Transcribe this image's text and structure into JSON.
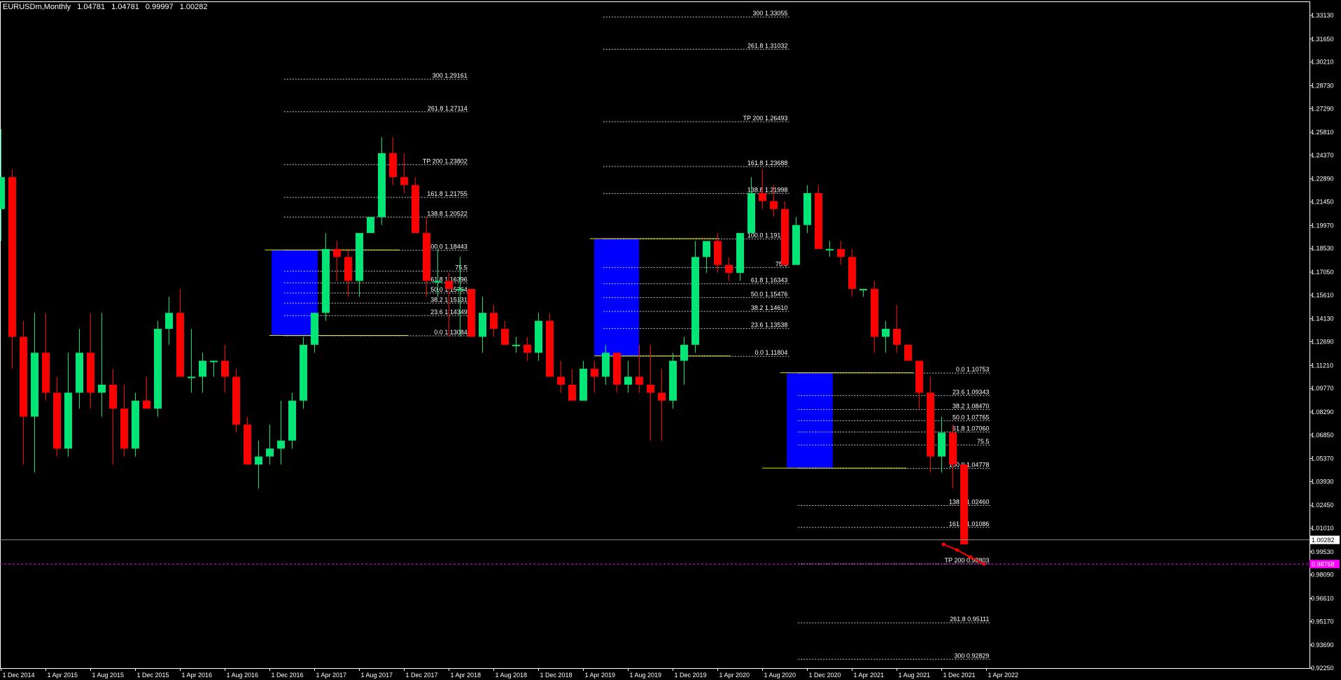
{
  "window": {
    "symbol": "EURUSDm,Monthly",
    "ohlc": [
      "1.04781",
      "1.04781",
      "0.99997",
      "1.00282"
    ]
  },
  "colors": {
    "background": "#000000",
    "bull": "#00e676",
    "bear": "#ff0000",
    "axis_text": "#ffffff",
    "fib_line": "#c8c8c8",
    "box": "#0000ff",
    "anchor_line": "#e6e600",
    "bid_line": "#8a8a8a",
    "target_line": "#ff00ff",
    "target_label_bg": "#ff00ff"
  },
  "price_axis": {
    "labels": [
      "1.33130",
      "1.31650",
      "1.30210",
      "1.28730",
      "1.27290",
      "1.25810",
      "1.24370",
      "1.22890",
      "1.21450",
      "1.19970",
      "1.18530",
      "1.17050",
      "1.15610",
      "1.14130",
      "1.12690",
      "1.11210",
      "1.09770",
      "1.08290",
      "1.06850",
      "1.05370",
      "1.03930",
      "1.02450",
      "1.01010",
      "0.99530",
      "0.98090",
      "0.96610",
      "0.95170",
      "0.93690",
      "0.92250"
    ],
    "current_price": "1.00282",
    "target_price": "0.98768"
  },
  "time_axis": {
    "labels": [
      "1 Dec 2014",
      "1 Apr 2015",
      "1 Aug 2015",
      "1 Dec 2015",
      "1 Apr 2016",
      "1 Aug 2016",
      "1 Dec 2016",
      "1 Apr 2017",
      "1 Aug 2017",
      "1 Dec 2017",
      "1 Apr 2018",
      "1 Aug 2018",
      "1 Dec 2018",
      "1 Apr 2019",
      "1 Aug 2019",
      "1 Dec 2019",
      "1 Apr 2020",
      "1 Aug 2020",
      "1 Dec 2020",
      "1 Apr 2021",
      "1 Aug 2021",
      "1 Dec 2021",
      "1 Apr 2022"
    ]
  },
  "chart_data": {
    "type": "candlestick",
    "first_bar": "1 Dec 2014",
    "y_range": [
      0.9225,
      1.3385
    ],
    "candles": [
      [
        1.21,
        1.26,
        1.19,
        1.23
      ],
      [
        1.23,
        1.235,
        1.11,
        1.13
      ],
      [
        1.13,
        1.14,
        1.05,
        1.08
      ],
      [
        1.08,
        1.145,
        1.045,
        1.12
      ],
      [
        1.12,
        1.145,
        1.09,
        1.095
      ],
      [
        1.095,
        1.105,
        1.055,
        1.06
      ],
      [
        1.06,
        1.12,
        1.055,
        1.095
      ],
      [
        1.095,
        1.135,
        1.085,
        1.12
      ],
      [
        1.12,
        1.145,
        1.085,
        1.095
      ],
      [
        1.095,
        1.145,
        1.08,
        1.1
      ],
      [
        1.1,
        1.11,
        1.05,
        1.085
      ],
      [
        1.085,
        1.1,
        1.055,
        1.06
      ],
      [
        1.06,
        1.095,
        1.055,
        1.09
      ],
      [
        1.09,
        1.105,
        1.085,
        1.085
      ],
      [
        1.085,
        1.14,
        1.08,
        1.135
      ],
      [
        1.135,
        1.155,
        1.125,
        1.145
      ],
      [
        1.145,
        1.16,
        1.105,
        1.105
      ],
      [
        1.105,
        1.135,
        1.095,
        1.105
      ],
      [
        1.105,
        1.12,
        1.095,
        1.115
      ],
      [
        1.115,
        1.115,
        1.105,
        1.115
      ],
      [
        1.115,
        1.125,
        1.095,
        1.105
      ],
      [
        1.105,
        1.11,
        1.07,
        1.075
      ],
      [
        1.075,
        1.08,
        1.05,
        1.05
      ],
      [
        1.05,
        1.065,
        1.035,
        1.055
      ],
      [
        1.055,
        1.075,
        1.05,
        1.06
      ],
      [
        1.06,
        1.09,
        1.05,
        1.065
      ],
      [
        1.065,
        1.095,
        1.06,
        1.09
      ],
      [
        1.09,
        1.13,
        1.085,
        1.125
      ],
      [
        1.125,
        1.145,
        1.12,
        1.145
      ],
      [
        1.145,
        1.195,
        1.14,
        1.185
      ],
      [
        1.185,
        1.19,
        1.165,
        1.18
      ],
      [
        1.18,
        1.185,
        1.155,
        1.165
      ],
      [
        1.165,
        1.195,
        1.155,
        1.195
      ],
      [
        1.195,
        1.205,
        1.195,
        1.205
      ],
      [
        1.205,
        1.255,
        1.2,
        1.245
      ],
      [
        1.245,
        1.255,
        1.225,
        1.23
      ],
      [
        1.23,
        1.245,
        1.22,
        1.225
      ],
      [
        1.225,
        1.23,
        1.215,
        1.195
      ],
      [
        1.195,
        1.205,
        1.155,
        1.165
      ],
      [
        1.165,
        1.185,
        1.155,
        1.165
      ],
      [
        1.165,
        1.17,
        1.13,
        1.16
      ],
      [
        1.16,
        1.18,
        1.13,
        1.16
      ],
      [
        1.16,
        1.16,
        1.13,
        1.13
      ],
      [
        1.13,
        1.155,
        1.12,
        1.145
      ],
      [
        1.145,
        1.15,
        1.13,
        1.135
      ],
      [
        1.135,
        1.14,
        1.125,
        1.125
      ],
      [
        1.125,
        1.13,
        1.12,
        1.125
      ],
      [
        1.125,
        1.13,
        1.115,
        1.12
      ],
      [
        1.12,
        1.145,
        1.115,
        1.14
      ],
      [
        1.14,
        1.145,
        1.105,
        1.105
      ],
      [
        1.105,
        1.115,
        1.095,
        1.1
      ],
      [
        1.1,
        1.11,
        1.09,
        1.09
      ],
      [
        1.09,
        1.115,
        1.09,
        1.11
      ],
      [
        1.11,
        1.115,
        1.095,
        1.105
      ],
      [
        1.105,
        1.125,
        1.1,
        1.12
      ],
      [
        1.12,
        1.12,
        1.095,
        1.1
      ],
      [
        1.1,
        1.115,
        1.095,
        1.105
      ],
      [
        1.105,
        1.125,
        1.095,
        1.1
      ],
      [
        1.1,
        1.125,
        1.065,
        1.095
      ],
      [
        1.095,
        1.11,
        1.065,
        1.09
      ],
      [
        1.09,
        1.12,
        1.085,
        1.115
      ],
      [
        1.115,
        1.13,
        1.1,
        1.125
      ],
      [
        1.125,
        1.19,
        1.12,
        1.18
      ],
      [
        1.18,
        1.19,
        1.17,
        1.19
      ],
      [
        1.19,
        1.195,
        1.17,
        1.175
      ],
      [
        1.175,
        1.18,
        1.165,
        1.17
      ],
      [
        1.17,
        1.195,
        1.165,
        1.195
      ],
      [
        1.195,
        1.23,
        1.195,
        1.22
      ],
      [
        1.22,
        1.235,
        1.21,
        1.215
      ],
      [
        1.215,
        1.225,
        1.205,
        1.21
      ],
      [
        1.21,
        1.215,
        1.175,
        1.175
      ],
      [
        1.175,
        1.205,
        1.175,
        1.2
      ],
      [
        1.2,
        1.225,
        1.195,
        1.22
      ],
      [
        1.22,
        1.225,
        1.185,
        1.185
      ],
      [
        1.185,
        1.19,
        1.18,
        1.185
      ],
      [
        1.185,
        1.19,
        1.175,
        1.18
      ],
      [
        1.18,
        1.185,
        1.155,
        1.16
      ],
      [
        1.16,
        1.16,
        1.155,
        1.16
      ],
      [
        1.16,
        1.165,
        1.12,
        1.13
      ],
      [
        1.13,
        1.14,
        1.12,
        1.135
      ],
      [
        1.135,
        1.15,
        1.12,
        1.125
      ],
      [
        1.125,
        1.125,
        1.115,
        1.115
      ],
      [
        1.115,
        1.115,
        1.085,
        1.095
      ],
      [
        1.095,
        1.105,
        1.045,
        1.055
      ],
      [
        1.055,
        1.08,
        1.045,
        1.07
      ],
      [
        1.07,
        1.075,
        1.035,
        1.05
      ],
      [
        1.05,
        1.05,
        1.0,
        1.0
      ]
    ],
    "fib_sets": [
      {
        "levels": [
          {
            "label": "300 1.29161",
            "value": 1.29161
          },
          {
            "label": "261.8 1.27114",
            "value": 1.27114
          },
          {
            "label": "TP 200 1.23802",
            "value": 1.23802
          },
          {
            "label": "161.8 1.21755",
            "value": 1.21755
          },
          {
            "label": "138.8 1.20522",
            "value": 1.20522
          },
          {
            "label": "100.0 1.18443",
            "value": 1.18443
          },
          {
            "label": "75.5",
            "value": 1.17133
          },
          {
            "label": "61.8 1.16396",
            "value": 1.16396
          },
          {
            "label": "50.0 1.15764",
            "value": 1.15764
          },
          {
            "label": "38.2 1.15131",
            "value": 1.15131
          },
          {
            "label": "23.6 1.14349",
            "value": 1.14349
          },
          {
            "label": "0.0 1.13084",
            "value": 1.13084
          }
        ]
      },
      {
        "levels": [
          {
            "label": "300 1.33055",
            "value": 1.33055
          },
          {
            "label": "261.8 1.31032",
            "value": 1.31032
          },
          {
            "label": "TP 200 1.26493",
            "value": 1.26493
          },
          {
            "label": "161.8 1.23688",
            "value": 1.23688
          },
          {
            "label": "138.8 1.21998",
            "value": 1.21998
          },
          {
            "label": "100.0 1.19149",
            "value": 1.19149
          },
          {
            "label": "75.5",
            "value": 1.1736
          },
          {
            "label": "61.8 1.16343",
            "value": 1.16343
          },
          {
            "label": "50.0 1.15476",
            "value": 1.15476
          },
          {
            "label": "38.2 1.14610",
            "value": 1.1461
          },
          {
            "label": "23.6 1.13538",
            "value": 1.13538
          },
          {
            "label": "0.0 1.11804",
            "value": 1.11804
          }
        ]
      },
      {
        "levels": [
          {
            "label": "0.0 1.10753",
            "value": 1.10753
          },
          {
            "label": "23.6 1.09343",
            "value": 1.09343
          },
          {
            "label": "38.2 1.08470",
            "value": 1.0847
          },
          {
            "label": "50.0 1.07765",
            "value": 1.07765
          },
          {
            "label": "61.8 1.07060",
            "value": 1.0706
          },
          {
            "label": "75.5",
            "value": 1.06241
          },
          {
            "label": "100.0 1.04778",
            "value": 1.04778
          },
          {
            "label": "138.8 1.02460",
            "value": 1.0246
          },
          {
            "label": "161.8 1.01086",
            "value": 1.01086
          },
          {
            "label": "TP 200 0.98803",
            "value": 0.98803
          },
          {
            "label": "261.8 0.95111",
            "value": 0.95111
          },
          {
            "label": "300 0.92829",
            "value": 0.92829
          }
        ]
      }
    ]
  }
}
